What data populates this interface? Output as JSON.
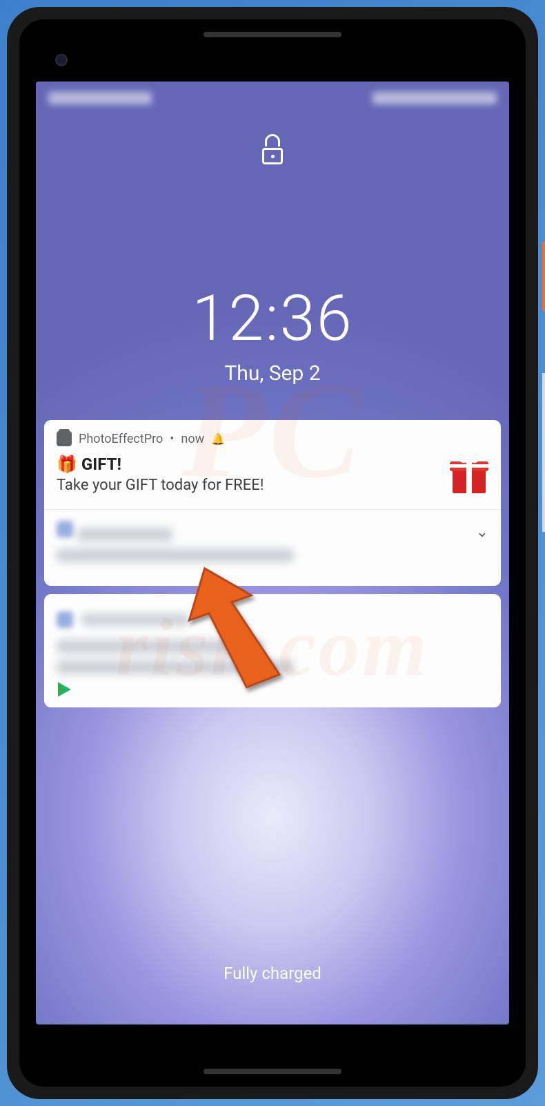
{
  "lockscreen": {
    "time": "12:36",
    "date": "Thu, Sep 2",
    "footer": "Fully charged"
  },
  "notification": {
    "app_name": "PhotoEffectPro",
    "time_label": "now",
    "separator": "•",
    "title_emoji": "🎁",
    "title": "GIFT!",
    "body": "Take your GIFT today for FREE!"
  },
  "watermark": {
    "line1": "PC",
    "line2": "risk.com"
  }
}
